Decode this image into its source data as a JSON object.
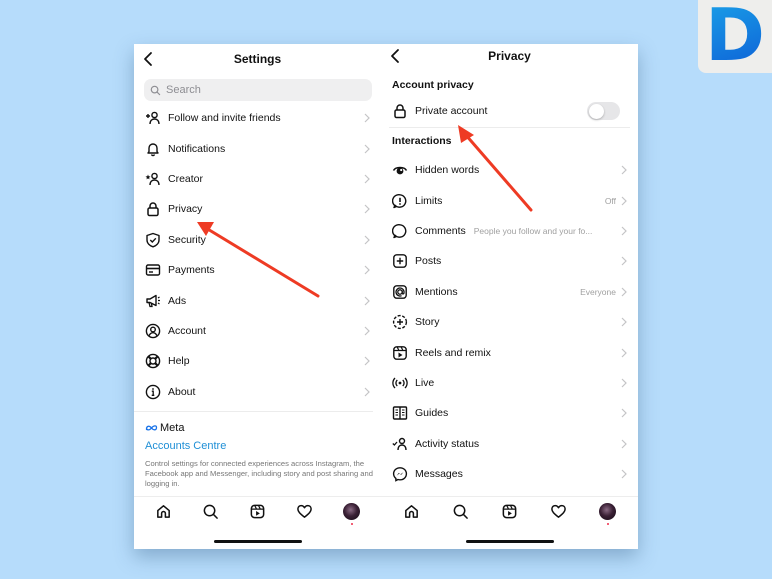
{
  "brand": {
    "logo_letter": "D"
  },
  "settings_screen": {
    "title": "Settings",
    "search": {
      "placeholder": "Search",
      "value": ""
    },
    "items": [
      {
        "label": "Follow and invite friends",
        "icon": "add-person-icon"
      },
      {
        "label": "Notifications",
        "icon": "bell-icon"
      },
      {
        "label": "Creator",
        "icon": "creator-icon"
      },
      {
        "label": "Privacy",
        "icon": "lock-icon"
      },
      {
        "label": "Security",
        "icon": "shield-check-icon"
      },
      {
        "label": "Payments",
        "icon": "card-icon"
      },
      {
        "label": "Ads",
        "icon": "megaphone-icon"
      },
      {
        "label": "Account",
        "icon": "account-circle-icon"
      },
      {
        "label": "Help",
        "icon": "lifebuoy-icon"
      },
      {
        "label": "About",
        "icon": "info-icon"
      }
    ],
    "meta": {
      "logo_text": "Meta",
      "accounts_centre_label": "Accounts Centre",
      "description": "Control settings for connected experiences across Instagram, the Facebook app and Messenger, including story and post sharing and logging in."
    }
  },
  "privacy_screen": {
    "title": "Privacy",
    "account_privacy_section": "Account privacy",
    "private_account": {
      "label": "Private account",
      "enabled": false
    },
    "interactions_section": "Interactions",
    "items": [
      {
        "label": "Hidden words",
        "value": "",
        "icon": "eye-icon"
      },
      {
        "label": "Limits",
        "value": "Off",
        "icon": "limits-icon"
      },
      {
        "label": "Comments",
        "value": "People you follow and your fo...",
        "icon": "comment-icon"
      },
      {
        "label": "Posts",
        "value": "",
        "icon": "plus-square-icon"
      },
      {
        "label": "Mentions",
        "value": "Everyone",
        "icon": "at-sign-icon"
      },
      {
        "label": "Story",
        "value": "",
        "icon": "story-add-icon"
      },
      {
        "label": "Reels and remix",
        "value": "",
        "icon": "reels-icon"
      },
      {
        "label": "Live",
        "value": "",
        "icon": "live-icon"
      },
      {
        "label": "Guides",
        "value": "",
        "icon": "guides-icon"
      },
      {
        "label": "Activity status",
        "value": "",
        "icon": "activity-status-icon"
      },
      {
        "label": "Messages",
        "value": "",
        "icon": "messenger-icon"
      }
    ]
  },
  "tab_bar": {
    "tabs": [
      "home-icon",
      "search-icon",
      "reels-icon",
      "heart-icon",
      "profile-avatar"
    ],
    "has_notification_dot": true
  },
  "annotations": {
    "arrow_color": "#ee3b24",
    "arrows": [
      {
        "points_to": "Privacy"
      },
      {
        "points_to": "Private account"
      }
    ]
  }
}
